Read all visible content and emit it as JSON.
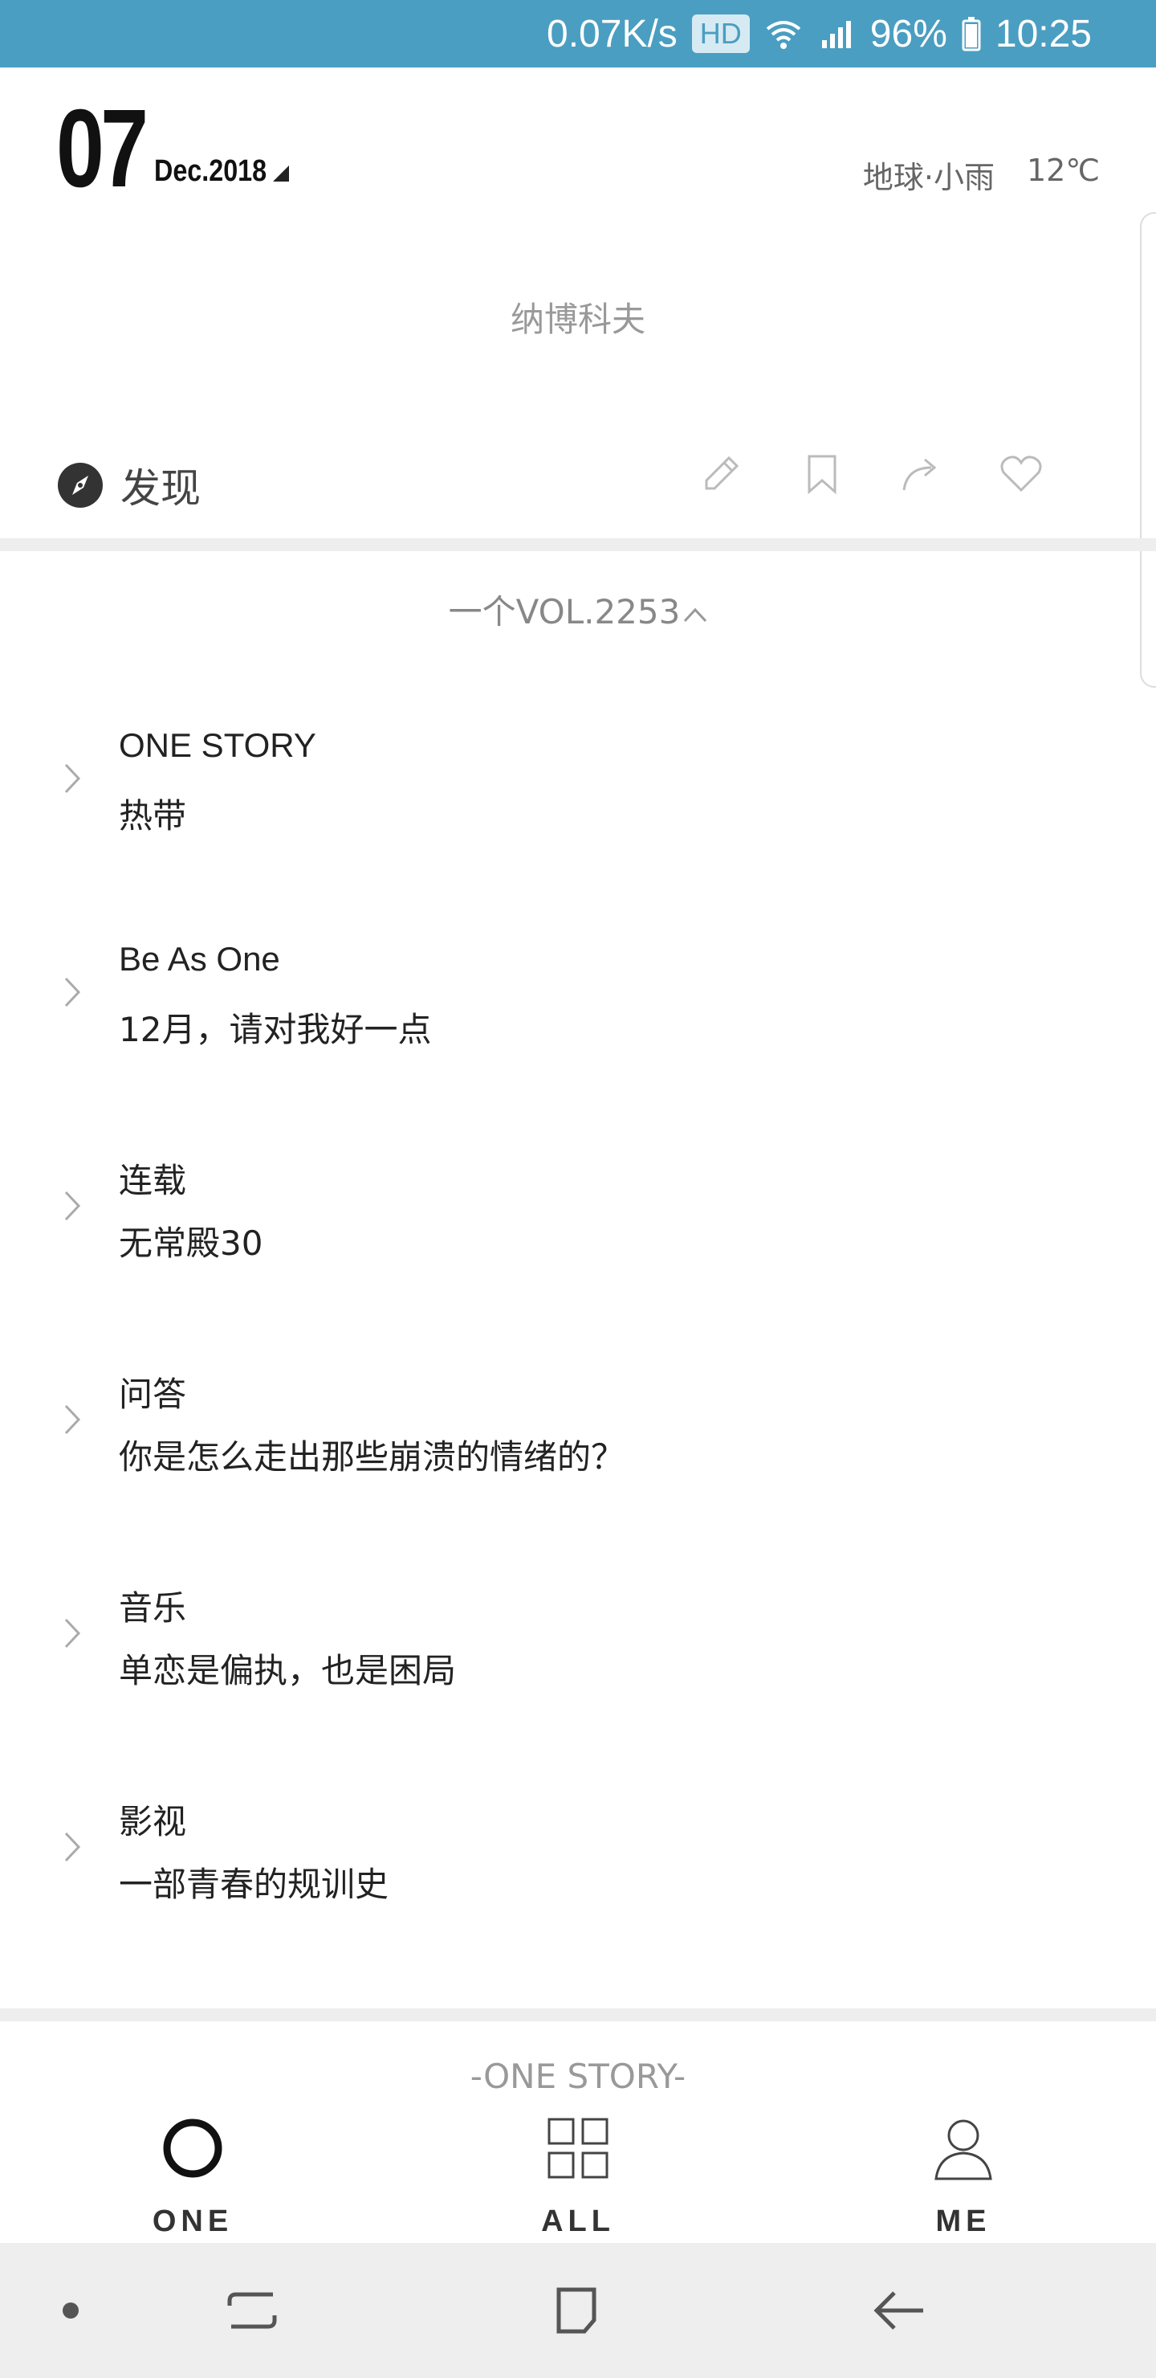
{
  "status_bar": {
    "speed": "0.07K/s",
    "hd": "HD",
    "battery": "96%",
    "time": "10:25",
    "background_color": "#4a9ec1"
  },
  "header": {
    "day": "07",
    "month_year": "Dec.2018",
    "location": "地球·小雨",
    "temperature": "12℃"
  },
  "author": "纳博科夫",
  "toolbar": {
    "discover_label": "发现",
    "icons": [
      "compass-icon",
      "pencil-icon",
      "bookmark-icon",
      "share-icon",
      "heart-icon"
    ]
  },
  "volume": {
    "label": "一个VOL.2253"
  },
  "items": [
    {
      "category": "ONE STORY",
      "title": "热带"
    },
    {
      "category": "Be As One",
      "title": "12月，请对我好一点"
    },
    {
      "category": "连载",
      "title": "无常殿30"
    },
    {
      "category": "问答",
      "title": "你是怎么走出那些崩溃的情绪的？"
    },
    {
      "category": "音乐",
      "title": "单恋是偏执，也是困局"
    },
    {
      "category": "影视",
      "title": "一部青春的规训史"
    }
  ],
  "section_label": "-ONE STORY-",
  "tabs": [
    {
      "label": "ONE",
      "icon": "circle-icon"
    },
    {
      "label": "ALL",
      "icon": "grid-icon"
    },
    {
      "label": "ME",
      "icon": "person-icon"
    }
  ],
  "nav": {
    "icons": [
      "dot-icon",
      "recents-icon",
      "home-icon",
      "back-icon"
    ]
  }
}
